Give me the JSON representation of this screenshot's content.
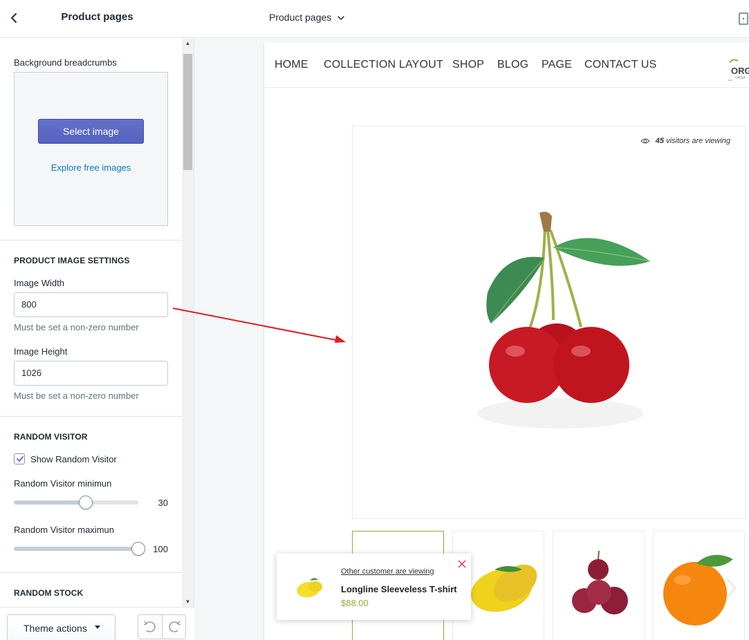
{
  "sidebar": {
    "title": "Product pages",
    "background_breadcrumbs": {
      "label": "Background breadcrumbs",
      "select_button": "Select image",
      "explore_link": "Explore free images"
    },
    "product_image_settings": {
      "heading": "PRODUCT IMAGE SETTINGS",
      "width_label": "Image Width",
      "width_value": "800",
      "width_help": "Must be set a non-zero number",
      "height_label": "Image Height",
      "height_value": "1026",
      "height_help": "Must be set a non-zero number"
    },
    "random_visitor": {
      "heading": "RANDOM VISITOR",
      "show_label": "Show Random Visitor",
      "show_checked": true,
      "min_label": "Random Visitor minimun",
      "min_value": "30",
      "min_fraction": 0.58,
      "max_label": "Random Visitor maximun",
      "max_value": "100",
      "max_fraction": 1.0
    },
    "random_stock": {
      "heading": "RANDOM STOCK"
    },
    "footer": {
      "theme_actions": "Theme actions"
    }
  },
  "topbar": {
    "page_select": "Product pages"
  },
  "preview": {
    "nav": {
      "items": [
        "HOME",
        "COLLECTION LAYOUT",
        "SHOP",
        "BLOG",
        "PAGE",
        "CONTACT US"
      ],
      "logo_text": "ORG",
      "logo_sub": "ORGA"
    },
    "product": {
      "visitors_count": "45",
      "visitors_text": "visitors are viewing"
    },
    "popup": {
      "link": "Other customer are viewing",
      "name": "Longline Sleeveless T-shirt",
      "price": "$88.00"
    }
  },
  "colors": {
    "primary_button": "#5c6ac4",
    "link": "#007ace",
    "active_thumb_border": "#96a93b",
    "price_green": "#8ab43a",
    "annotation_arrow": "#e31b1b"
  }
}
